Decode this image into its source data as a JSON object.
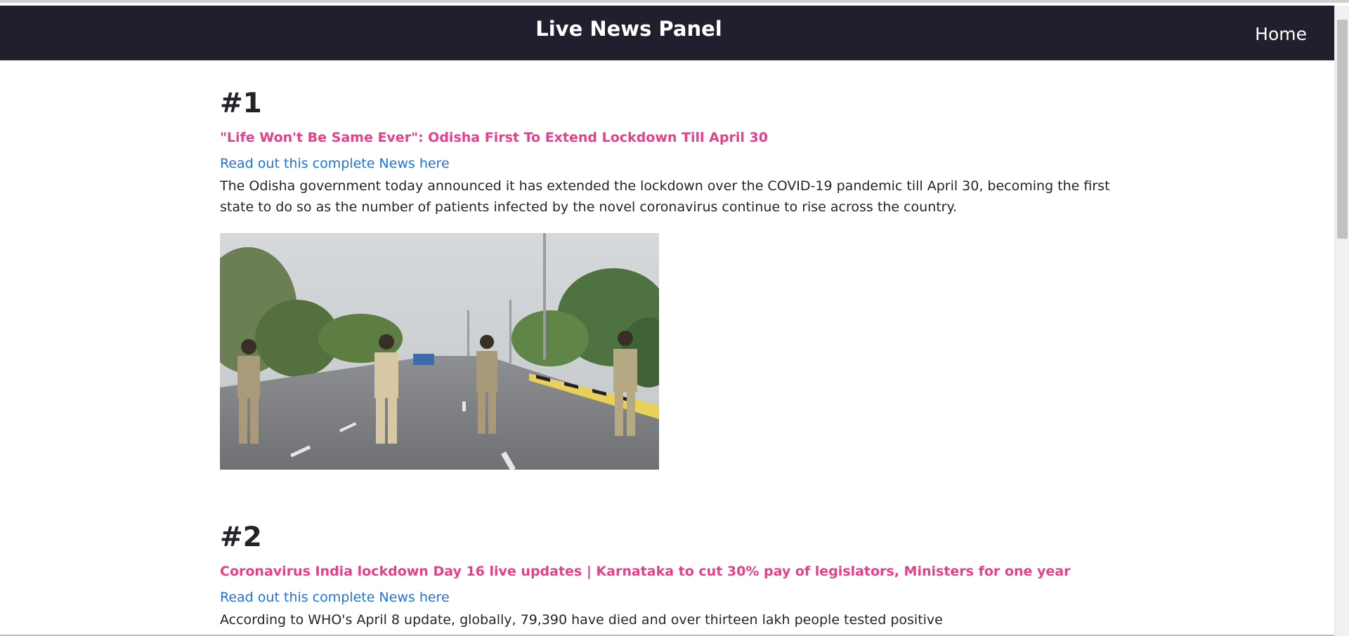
{
  "header": {
    "title": "Live News Panel",
    "home_label": "Home"
  },
  "articles": [
    {
      "number": "#1",
      "headline": "\"Life Won't Be Same Ever\": Odisha First To Extend Lockdown Till April 30",
      "link_text": "Read out this complete News here",
      "description": "The Odisha government today announced it has extended the lockdown over the COVID-19 pandemic till April 30, becoming the first state to do so as the number of patients infected by the novel coronavirus continue to rise across the country."
    },
    {
      "number": "#2",
      "headline": "Coronavirus India lockdown Day 16 live updates | Karnataka to cut 30% pay of legislators, Ministers for one year",
      "link_text": "Read out this complete News here",
      "description": "According to WHO's April 8 update, globally, 79,390 have died and over thirteen lakh people tested positive"
    }
  ],
  "colors": {
    "navbar_bg": "#1f1f2e",
    "headline": "#e83e8c",
    "link": "#1a73e8"
  }
}
